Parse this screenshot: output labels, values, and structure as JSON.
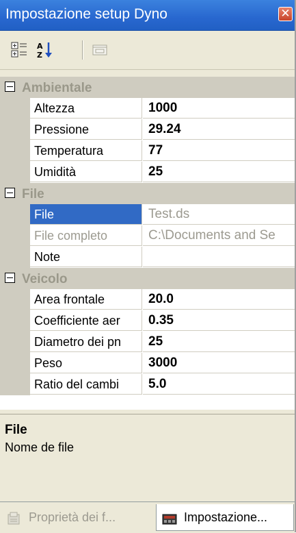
{
  "window": {
    "title": "Impostazione setup Dyno",
    "close_glyph": "✕"
  },
  "toolbar": {
    "icons": [
      "categorized-icon",
      "alphabetical-icon",
      "property-pages-icon"
    ]
  },
  "grid": {
    "categories": [
      {
        "label": "Ambientale",
        "rows": [
          {
            "name": "Altezza",
            "value": "1000"
          },
          {
            "name": "Pressione",
            "value": "29.24"
          },
          {
            "name": "Temperatura",
            "value": "77"
          },
          {
            "name": "Umidità",
            "value": "25"
          }
        ]
      },
      {
        "label": "File",
        "rows": [
          {
            "name": "File",
            "value": "Test.ds",
            "selected": true
          },
          {
            "name": "File completo",
            "value": "C:\\Documents and Se"
          },
          {
            "name": "Note",
            "value": ""
          }
        ]
      },
      {
        "label": "Veicolo",
        "rows": [
          {
            "name": "Area frontale",
            "value": "20.0"
          },
          {
            "name": "Coefficiente aer",
            "value": "0.35"
          },
          {
            "name": "Diametro dei pn",
            "value": "25"
          },
          {
            "name": "Peso",
            "value": "3000"
          },
          {
            "name": "Ratio del cambi",
            "value": "5.0"
          }
        ]
      }
    ]
  },
  "description": {
    "title": "File",
    "text": "Nome de file"
  },
  "tabs": [
    {
      "label": "Proprietà dei f...",
      "icon": "properties-icon",
      "active": false
    },
    {
      "label": "Impostazione...",
      "icon": "dyno-setup-icon",
      "active": true
    }
  ],
  "colors": {
    "titlebar": "#2867cf",
    "selection": "#316ac5",
    "category_band": "#cfccc0"
  }
}
